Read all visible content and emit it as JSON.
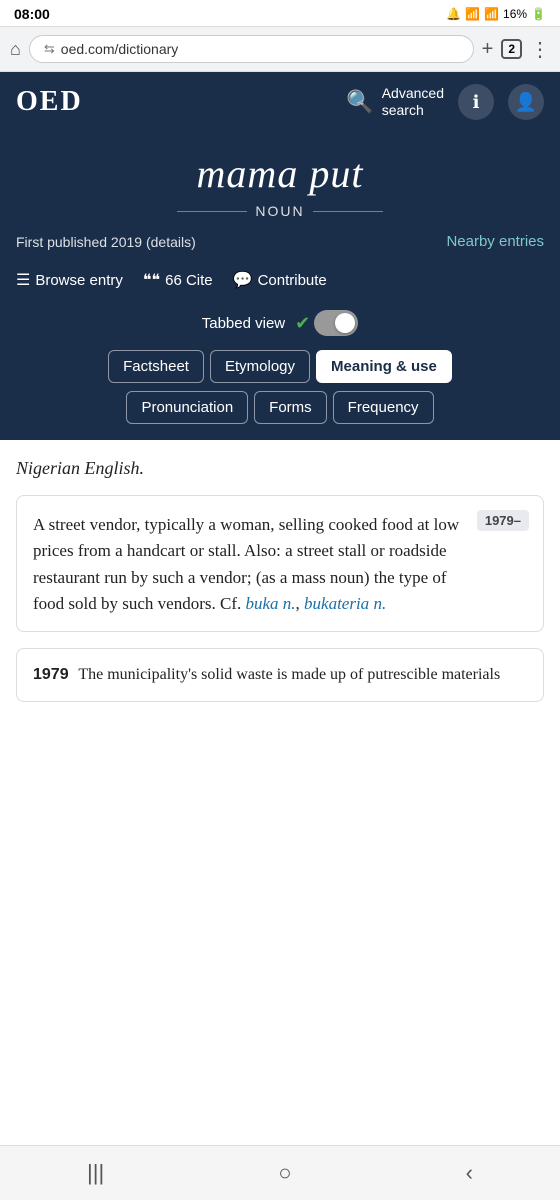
{
  "statusBar": {
    "time": "08:00",
    "icons": "🔔 📶 16%"
  },
  "browserBar": {
    "homeIcon": "⌂",
    "urlIcon": "⇆",
    "url": "oed.com/dictionary",
    "addTab": "+",
    "tabCount": "2",
    "menuIcon": "⋮"
  },
  "header": {
    "logo": "OED",
    "searchIcon": "🔍",
    "advancedSearch": "Advanced\nsearch",
    "advancedSearchLine1": "Advanced",
    "advancedSearchLine2": "search",
    "infoIcon": "ℹ",
    "userIcon": "👤"
  },
  "entry": {
    "word": "mama put",
    "pos": "NOUN",
    "published": "First published 2019 (details)",
    "nearbyEntries": "Nearby entries",
    "actions": {
      "browse": "Browse entry",
      "cite": "66 Cite",
      "contribute": "Contribute"
    },
    "tabbedView": "Tabbed view",
    "tabs": {
      "row1": [
        "Factsheet",
        "Etymology",
        "Meaning & use"
      ],
      "row2": [
        "Pronunciation",
        "Forms",
        "Frequency"
      ]
    },
    "activeTab": "Meaning & use"
  },
  "content": {
    "languageLabel": "Nigerian English.",
    "dateBadge": "1979–",
    "definition": "A street vendor, typically a woman, selling cooked food at low prices from a handcart or stall. Also: a street stall or roadside restaurant run by such a vendor; (as a mass noun) the type of food sold by such vendors. Cf.",
    "defLinks": [
      "buka n.",
      "bukateria n."
    ],
    "quote": {
      "year": "1979",
      "text": "The municipality's solid waste is made up of putrescible materials"
    }
  },
  "bottomNav": {
    "back": "‹",
    "home": "○",
    "forward": "›"
  }
}
